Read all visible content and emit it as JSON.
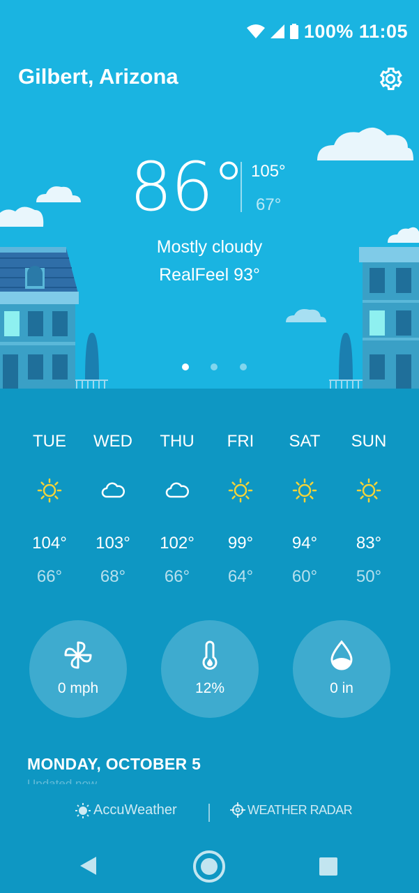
{
  "status_bar": {
    "battery": "100%",
    "time": "11:05"
  },
  "header": {
    "location": "Gilbert, Arizona"
  },
  "current": {
    "temp": "86°",
    "high": "105°",
    "low": "67°",
    "condition": "Mostly cloudy",
    "realfeel": "RealFeel 93°"
  },
  "pager": {
    "pages": 3,
    "active": 0
  },
  "forecast": [
    {
      "day": "TUE",
      "icon": "sun-icon",
      "high": "104°",
      "low": "66°"
    },
    {
      "day": "WED",
      "icon": "cloud-icon",
      "high": "103°",
      "low": "68°"
    },
    {
      "day": "THU",
      "icon": "cloud-icon",
      "high": "102°",
      "low": "66°"
    },
    {
      "day": "FRI",
      "icon": "sun-icon",
      "high": "99°",
      "low": "64°"
    },
    {
      "day": "SAT",
      "icon": "sun-icon",
      "high": "94°",
      "low": "60°"
    },
    {
      "day": "SUN",
      "icon": "sun-icon",
      "high": "83°",
      "low": "50°"
    }
  ],
  "details": {
    "wind": "0 mph",
    "humidity": "12%",
    "precipitation": "0 in"
  },
  "date": "MONDAY, OCTOBER 5",
  "updated": "Updated now",
  "footer": {
    "accuweather": "AccuWeather",
    "radar": "WEATHER RADAR"
  },
  "colors": {
    "sky": "#1ab4e1",
    "panel": "#0e97c3",
    "sun": "#f2d33a",
    "building": "#3aa0c6",
    "building_light": "#5ab8d9"
  }
}
